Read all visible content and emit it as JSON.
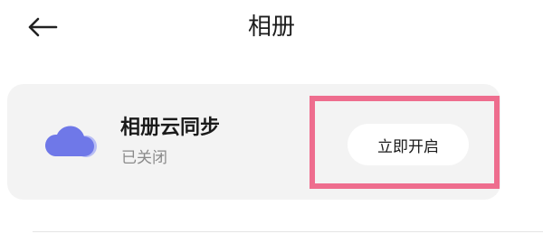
{
  "header": {
    "back_icon": "arrow-left-icon",
    "title": "相册"
  },
  "sync_card": {
    "icon": "cloud-icon",
    "icon_color": "#6f78e8",
    "title": "相册云同步",
    "status": "已关闭",
    "enable_button_label": "立即开启"
  },
  "colors": {
    "card_background": "#f3f3f3",
    "highlight_border": "#ee6d8e"
  }
}
